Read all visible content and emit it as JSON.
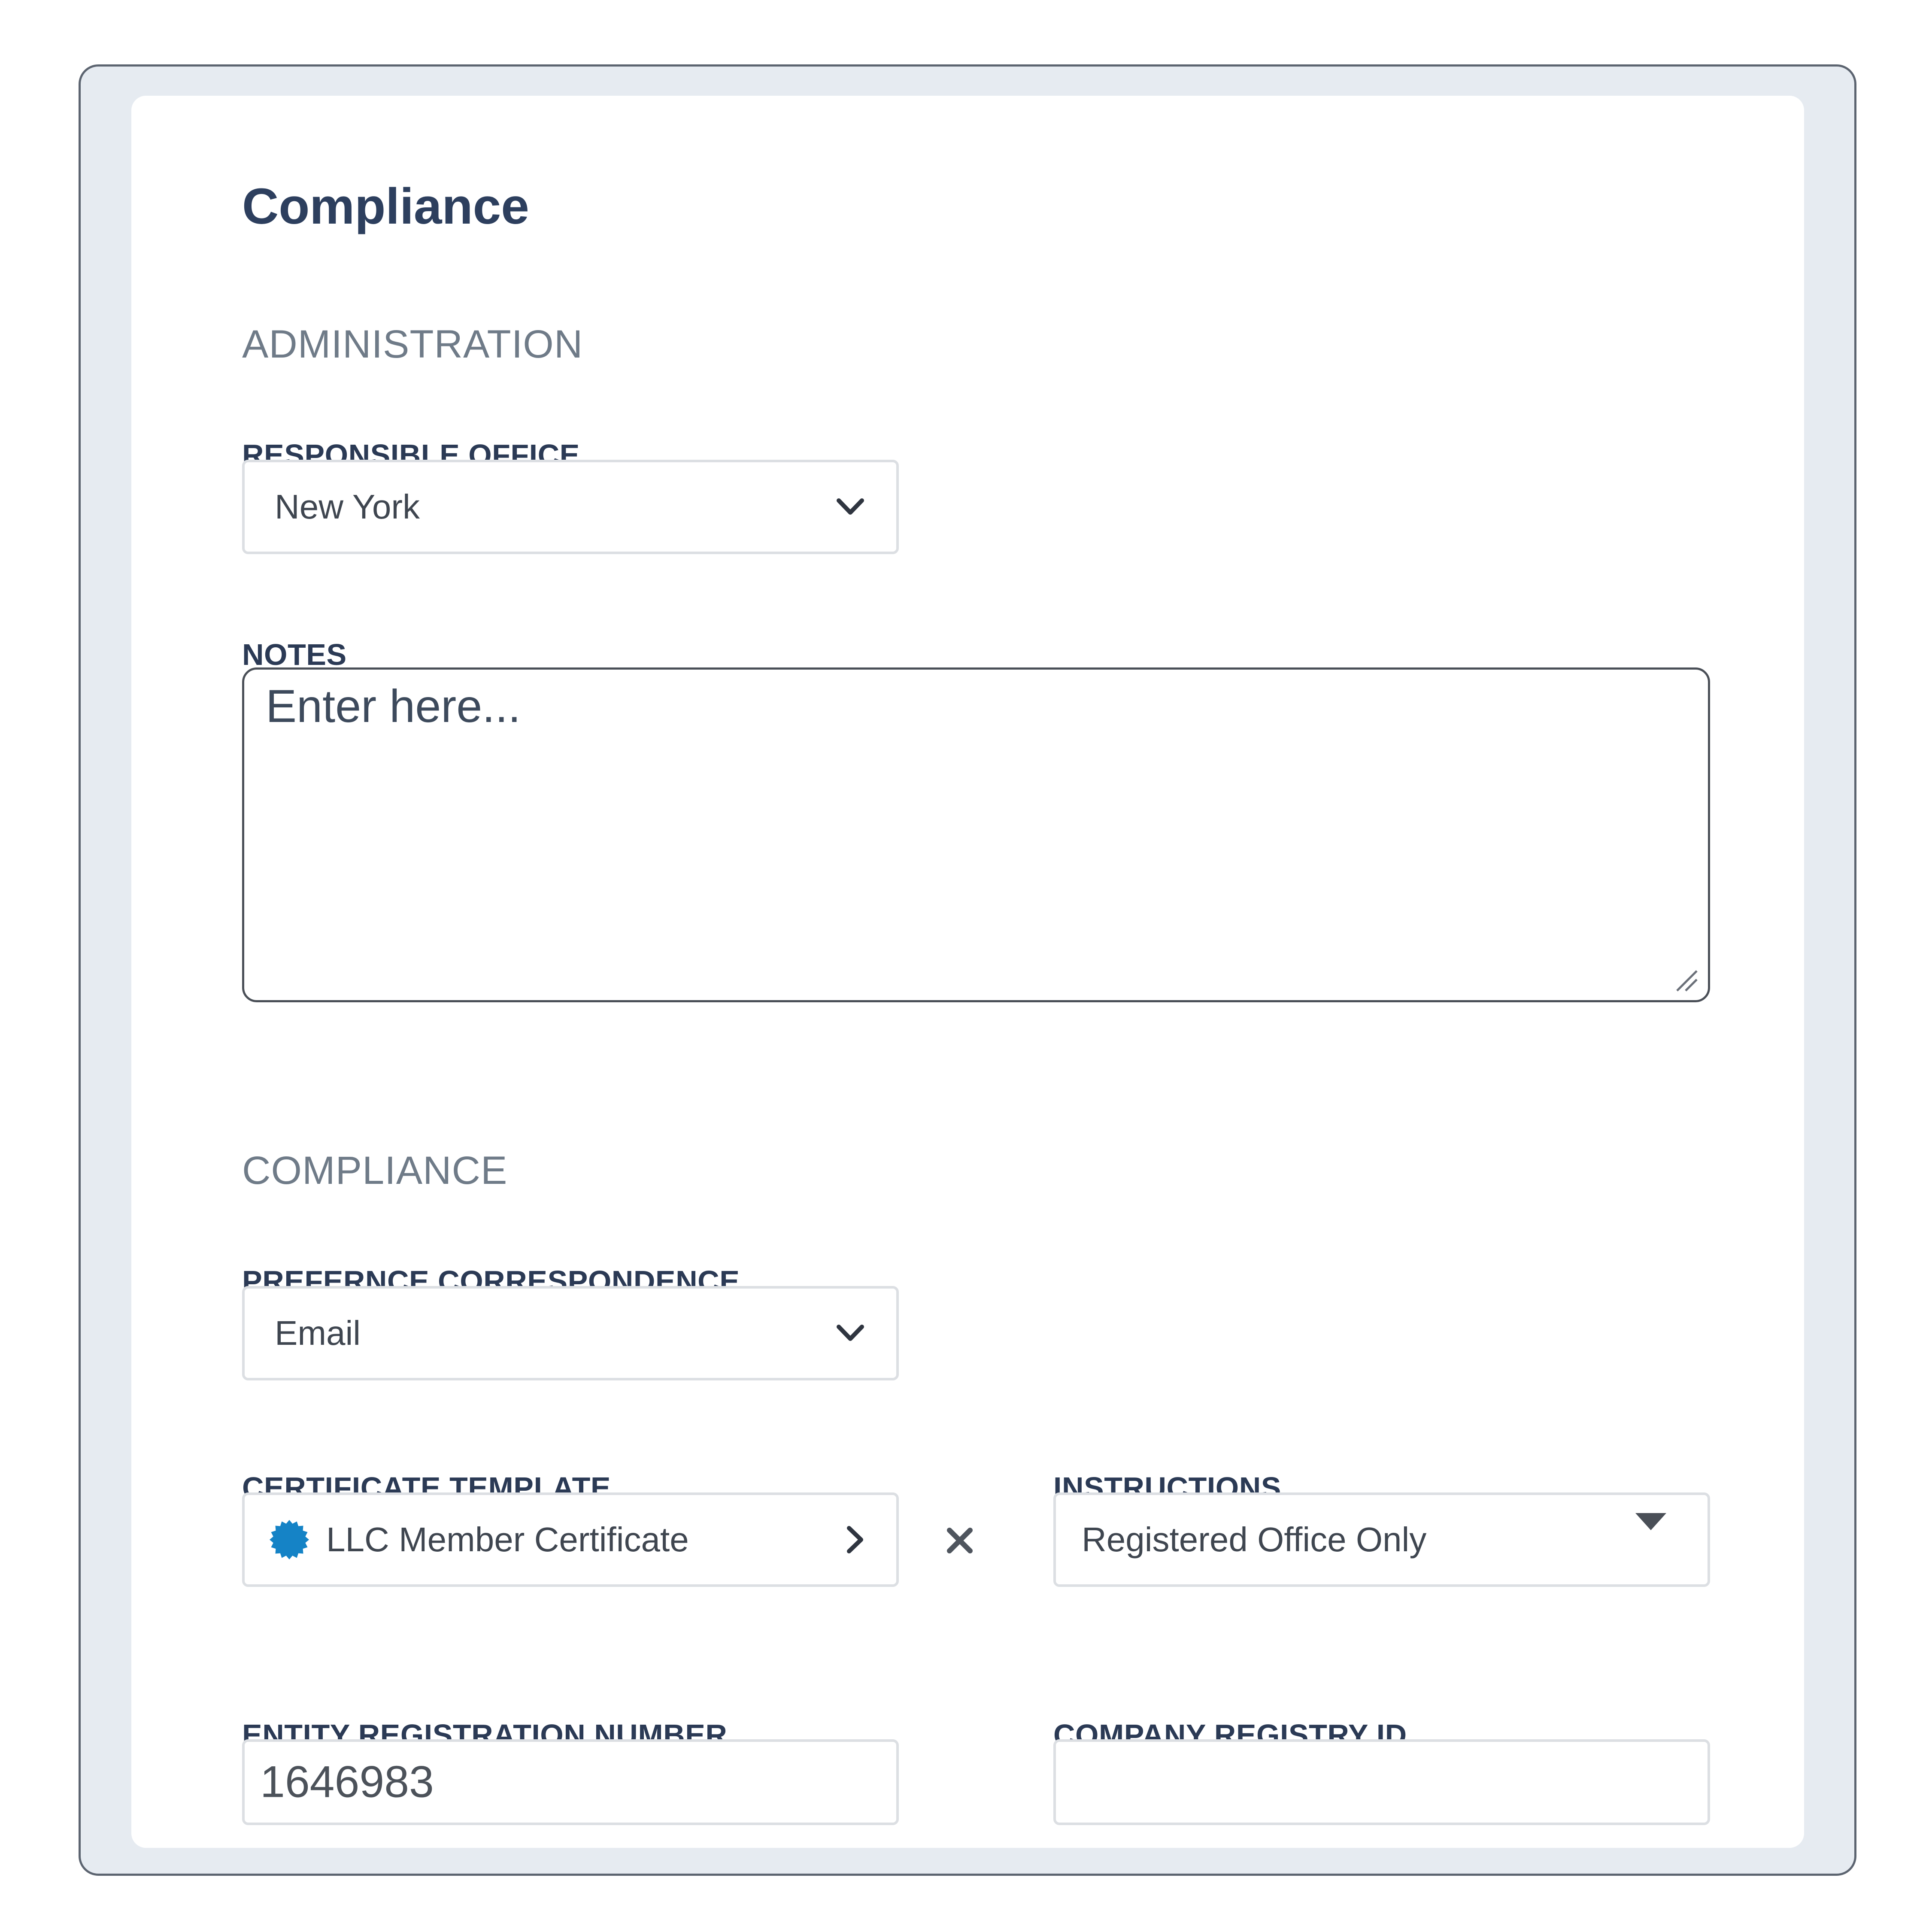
{
  "page": {
    "title": "Compliance"
  },
  "administration": {
    "section_title": "ADMINISTRATION",
    "responsible_office": {
      "label": "RESPONSIBLE OFFICE",
      "value": "New York"
    },
    "notes": {
      "label": "NOTES",
      "placeholder": "Enter here..."
    }
  },
  "compliance": {
    "section_title": "COMPLIANCE",
    "preference_correspondence": {
      "label": "PREFERNCE CORRESPONDENCE",
      "value": "Email"
    },
    "certificate_template": {
      "label": "CERTIFICATE TEMPLATE",
      "value": "LLC Member Certificate",
      "badge_icon": "seal-badge-icon",
      "badge_color": "#1583c6"
    },
    "instructions": {
      "label": "INSTRUCTIONS",
      "value": "Registered Office Only"
    },
    "entity_registration_number": {
      "label": "ENTITY REGISTRATION NUMBER",
      "value": "1646983"
    },
    "company_registry_id": {
      "label": "COMPANY REGISTRY ID",
      "value": ""
    }
  },
  "colors": {
    "frame_background": "#e6ebf1",
    "heading": "#2d3f5e",
    "section_heading": "#6f7b88",
    "field_border": "#dcdfe3"
  }
}
